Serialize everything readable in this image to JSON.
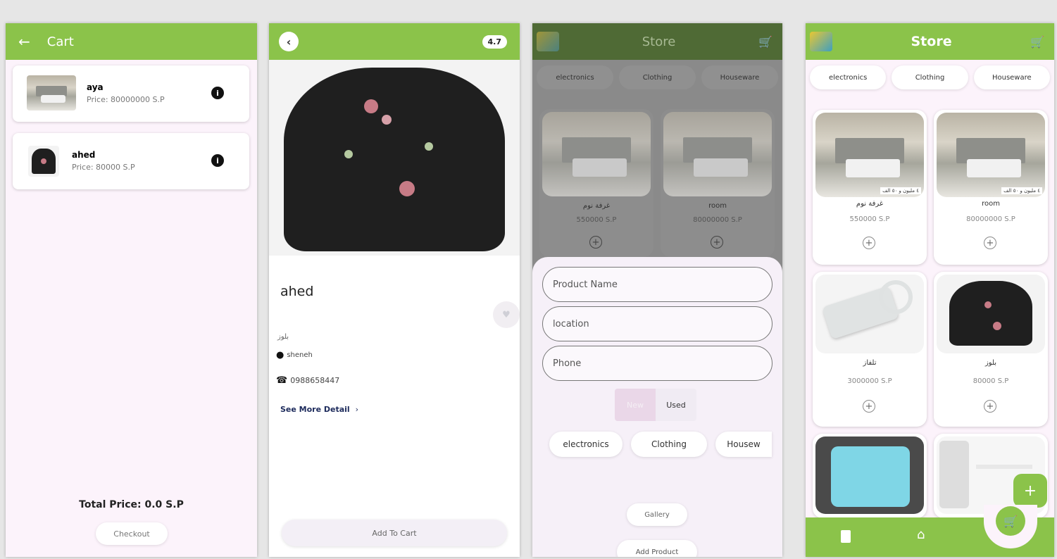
{
  "cart": {
    "title": "Cart",
    "items": [
      {
        "name": "aya",
        "price": "Price: 80000000 S.P"
      },
      {
        "name": "ahed",
        "price": "Price: 80000 S.P"
      }
    ],
    "total": "Total Price: 0.0 S.P",
    "checkout_label": "Checkout"
  },
  "detail": {
    "rating": "4.7",
    "name": "ahed",
    "category": "بلوز",
    "location": "sheneh",
    "phone": "0988658447",
    "more_label": "See More Detail",
    "add_to_cart_label": "Add To Cart"
  },
  "add_form": {
    "title": "Store",
    "categories": [
      "electronics",
      "Clothing",
      "Houseware"
    ],
    "background_products": [
      {
        "name": "غرفة نوم",
        "price": "550000 S.P"
      },
      {
        "name": "room",
        "price": "80000000 S.P"
      }
    ],
    "fields": {
      "product_name": "Product Name",
      "location": "location",
      "phone": "Phone"
    },
    "condition": {
      "new": "New",
      "used": "Used"
    },
    "form_categories": [
      "electronics",
      "Clothing",
      "Housew"
    ],
    "gallery_label": "Gallery",
    "add_product_label": "Add Product"
  },
  "store": {
    "title": "Store",
    "categories": [
      "electronics",
      "Clothing",
      "Houseware"
    ],
    "products": [
      {
        "name": "غرفة نوم",
        "price": "550000 S.P",
        "tag": "٤ مليون و ٥٠ الف"
      },
      {
        "name": "room",
        "price": "80000000 S.P",
        "tag": "٤ مليون و ٥٠ الف"
      },
      {
        "name": "تلفاز",
        "price": "3000000 S.P"
      },
      {
        "name": "بلوز",
        "price": "80000 S.P"
      }
    ],
    "fab_label": "+"
  },
  "colors": {
    "accent": "#8bc34a",
    "background_tint": "#fcf3fb"
  }
}
